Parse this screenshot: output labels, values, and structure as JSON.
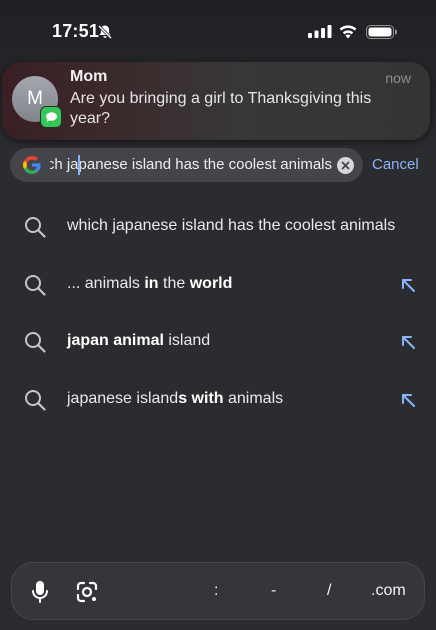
{
  "status_bar": {
    "time": "17:51",
    "icons": [
      "bell-off-icon",
      "signal-icon",
      "wifi-icon",
      "battery-icon"
    ]
  },
  "notification": {
    "avatar_initial": "M",
    "sender": "Mom",
    "time": "now",
    "message": "Are you bringing a girl to Thanksgiving this year?",
    "app_icon": "messages-icon"
  },
  "search": {
    "query": "which japanese island has the coolest animals",
    "cancel_label": "Cancel",
    "icons": [
      "google-icon",
      "clear-icon"
    ]
  },
  "suggestions": [
    {
      "segments": [
        {
          "text": "which japanese island has the coolest animals",
          "bold": false
        }
      ],
      "fill_arrow": false
    },
    {
      "segments": [
        {
          "text": "... animals ",
          "bold": false
        },
        {
          "text": "in",
          "bold": true
        },
        {
          "text": " the ",
          "bold": false
        },
        {
          "text": "world",
          "bold": true
        }
      ],
      "fill_arrow": true
    },
    {
      "segments": [
        {
          "text": "japan animal",
          "bold": true
        },
        {
          "text": " island",
          "bold": false
        }
      ],
      "fill_arrow": true
    },
    {
      "segments": [
        {
          "text": "japanese island",
          "bold": false
        },
        {
          "text": "s with",
          "bold": true
        },
        {
          "text": " animals",
          "bold": false
        }
      ],
      "fill_arrow": true
    }
  ],
  "bottom_bar": {
    "keys": [
      ":",
      "-",
      "/",
      ".com"
    ],
    "icons": [
      "microphone-icon",
      "google-lens-icon"
    ]
  },
  "colors": {
    "background": "#2b2c2f",
    "accent": "#8ab4f8",
    "search_pill": "#43454b",
    "messages_green": "#34c759"
  }
}
